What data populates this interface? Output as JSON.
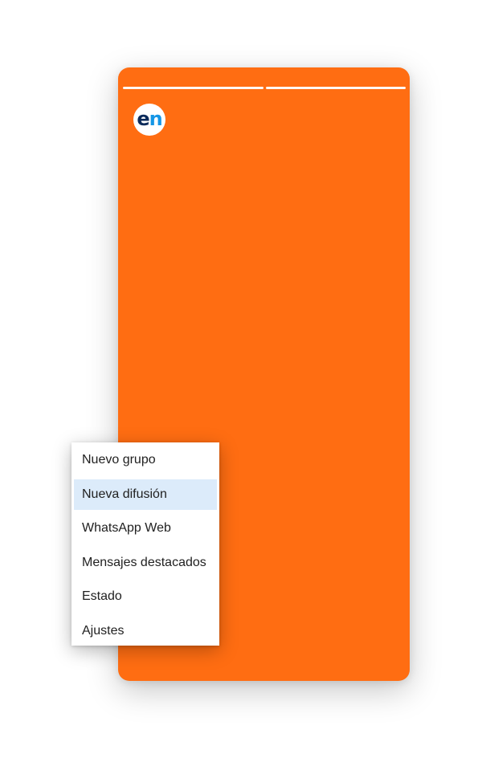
{
  "story": {
    "background_color": "#ff6d12",
    "progress_segments": 2,
    "avatar": {
      "logo_part1": "e",
      "logo_part2": "n"
    }
  },
  "menu": {
    "items": [
      {
        "label": "Nuevo grupo",
        "highlighted": false
      },
      {
        "label": "Nueva difusión",
        "highlighted": true
      },
      {
        "label": "WhatsApp Web",
        "highlighted": false
      },
      {
        "label": "Mensajes destacados",
        "highlighted": false
      },
      {
        "label": "Estado",
        "highlighted": false
      },
      {
        "label": "Ajustes",
        "highlighted": false
      }
    ]
  }
}
